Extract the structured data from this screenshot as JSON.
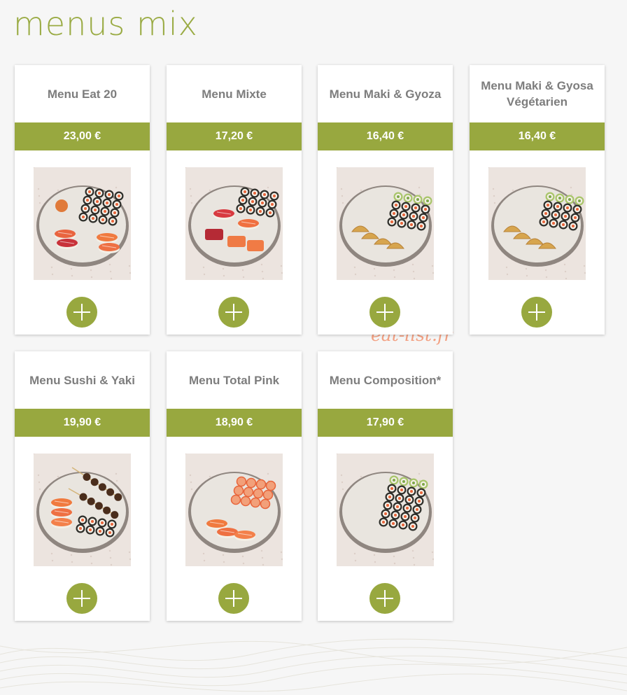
{
  "page": {
    "title": "menus mix",
    "watermark": "eat-list.fr",
    "accent_color": "#98a83f",
    "title_color": "#9aab44"
  },
  "menus": [
    {
      "name": "Menu Eat 20",
      "price": "23,00 €",
      "image": "sushi-platter-nigiri-maki",
      "button_icon": "plus-icon"
    },
    {
      "name": "Menu Mixte",
      "price": "17,20 €",
      "image": "sushi-platter-sashimi-maki",
      "button_icon": "plus-icon"
    },
    {
      "name": "Menu Maki & Gyoza",
      "price": "16,40 €",
      "image": "sushi-platter-maki-gyoza",
      "button_icon": "plus-icon"
    },
    {
      "name": "Menu Maki & Gyosa Végétarien",
      "price": "16,40 €",
      "image": "sushi-platter-veggie-maki-gyoza",
      "button_icon": "plus-icon"
    },
    {
      "name": "Menu Sushi & Yaki",
      "price": "19,90 €",
      "image": "sushi-platter-nigiri-yakitori",
      "button_icon": "plus-icon"
    },
    {
      "name": "Menu Total Pink",
      "price": "18,90 €",
      "image": "sushi-platter-salmon",
      "button_icon": "plus-icon"
    },
    {
      "name": "Menu Composition*",
      "price": "17,90 €",
      "image": "sushi-platter-maki-rolls",
      "button_icon": "plus-icon"
    }
  ]
}
